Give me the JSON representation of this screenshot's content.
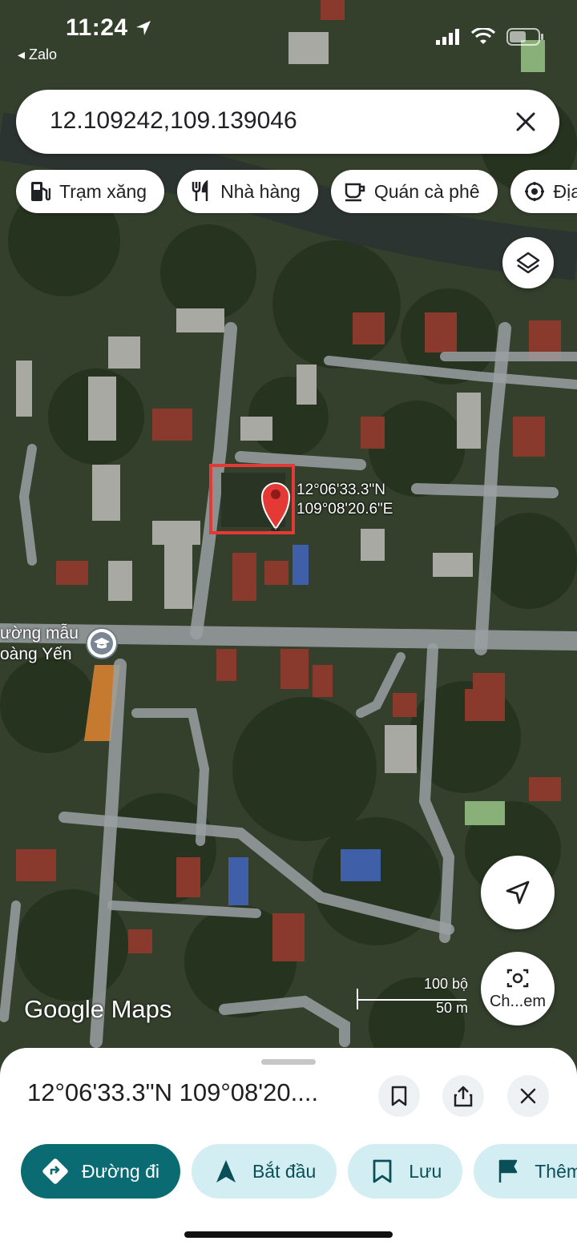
{
  "status_bar": {
    "time": "11:24",
    "back_app": "◂ Zalo"
  },
  "search": {
    "query": "12.109242,109.139046"
  },
  "chips": [
    {
      "label": "Trạm xăng",
      "icon": "gas-station-icon"
    },
    {
      "label": "Nhà hàng",
      "icon": "restaurant-icon"
    },
    {
      "label": "Quán cà phê",
      "icon": "coffee-icon"
    },
    {
      "label": "Địa",
      "icon": "attraction-icon"
    }
  ],
  "pin": {
    "lat": "12°06'33.3\"N",
    "lng": "109°08'20.6\"E"
  },
  "school_label": {
    "line1": "ường mẫu",
    "line2": "oàng Yến"
  },
  "map_logo": "Google Maps",
  "scale": {
    "feet": "100 bộ",
    "meters": "50 m"
  },
  "lens_button": {
    "label": "Ch...em"
  },
  "bottom_sheet": {
    "title": "12°06'33.3\"N 109°08'20...."
  },
  "actions": [
    {
      "label": "Đường đi",
      "icon": "directions-icon"
    },
    {
      "label": "Bắt đầu",
      "icon": "navigation-arrow-icon"
    },
    {
      "label": "Lưu",
      "icon": "bookmark-icon"
    },
    {
      "label": "Thêm",
      "icon": "flag-icon"
    }
  ],
  "colors": {
    "accent": "#0b6b73",
    "pin": "#e53935",
    "chip_bg": "#ffffff"
  }
}
